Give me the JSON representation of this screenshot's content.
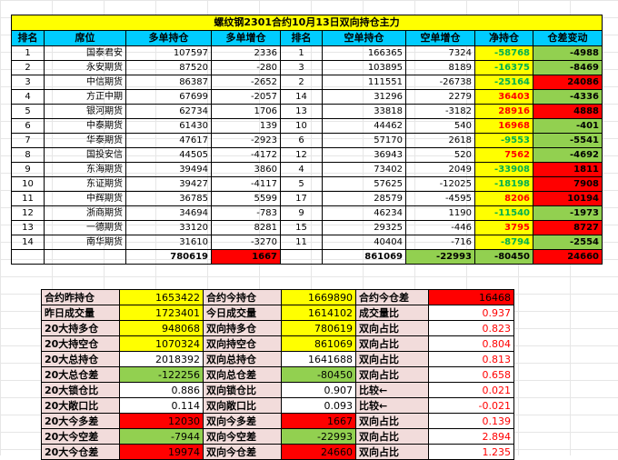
{
  "title": "螺纹钢2301合约10月13日双向持仓主力",
  "headers": [
    "排名",
    "席位",
    "多单持仓",
    "多单增仓",
    "排名",
    "空单持仓",
    "空单增仓",
    "净持仓",
    "仓差变动"
  ],
  "rows": [
    {
      "rank": "1",
      "broker": "国泰君安",
      "long": "107597",
      "long_chg": "2336",
      "srank": "1",
      "short": "166365",
      "short_chg": "7324",
      "net": "-58768",
      "diff": "-4988",
      "net_color": "yel",
      "net_text": "lgreen",
      "diff_color": "grn"
    },
    {
      "rank": "2",
      "broker": "永安期货",
      "long": "87520",
      "long_chg": "-280",
      "srank": "3",
      "short": "103895",
      "short_chg": "8189",
      "net": "-16375",
      "diff": "-8469",
      "net_color": "yel",
      "net_text": "lgreen",
      "diff_color": "grn"
    },
    {
      "rank": "3",
      "broker": "中信期货",
      "long": "86387",
      "long_chg": "-2652",
      "srank": "2",
      "short": "111551",
      "short_chg": "-26738",
      "net": "-25164",
      "diff": "24086",
      "net_color": "yel",
      "net_text": "lgreen",
      "diff_color": "red"
    },
    {
      "rank": "4",
      "broker": "方正中期",
      "long": "67699",
      "long_chg": "-2057",
      "srank": "14",
      "short": "31296",
      "short_chg": "2279",
      "net": "36403",
      "diff": "-4336",
      "net_color": "yel",
      "net_text": "red",
      "diff_color": "grn"
    },
    {
      "rank": "5",
      "broker": "银河期货",
      "long": "62734",
      "long_chg": "1706",
      "srank": "13",
      "short": "33818",
      "short_chg": "-3182",
      "net": "28916",
      "diff": "4888",
      "net_color": "yel",
      "net_text": "red",
      "diff_color": "red"
    },
    {
      "rank": "6",
      "broker": "中泰期货",
      "long": "61430",
      "long_chg": "139",
      "srank": "10",
      "short": "44462",
      "short_chg": "540",
      "net": "16968",
      "diff": "-401",
      "net_color": "yel",
      "net_text": "red",
      "diff_color": "grn"
    },
    {
      "rank": "7",
      "broker": "华泰期货",
      "long": "47617",
      "long_chg": "-2923",
      "srank": "6",
      "short": "57170",
      "short_chg": "2618",
      "net": "-9553",
      "diff": "-5541",
      "net_color": "yel",
      "net_text": "lgreen",
      "diff_color": "grn"
    },
    {
      "rank": "8",
      "broker": "国投安信",
      "long": "44505",
      "long_chg": "-4172",
      "srank": "12",
      "short": "36943",
      "short_chg": "520",
      "net": "7562",
      "diff": "-4692",
      "net_color": "yel",
      "net_text": "red",
      "diff_color": "grn"
    },
    {
      "rank": "9",
      "broker": "东海期货",
      "long": "39494",
      "long_chg": "3860",
      "srank": "4",
      "short": "73402",
      "short_chg": "2049",
      "net": "-33908",
      "diff": "1811",
      "net_color": "yel",
      "net_text": "lgreen",
      "diff_color": "red"
    },
    {
      "rank": "10",
      "broker": "东证期货",
      "long": "39427",
      "long_chg": "-4117",
      "srank": "5",
      "short": "57625",
      "short_chg": "-12025",
      "net": "-18198",
      "diff": "7908",
      "net_color": "yel",
      "net_text": "lgreen",
      "diff_color": "red"
    },
    {
      "rank": "11",
      "broker": "中辉期货",
      "long": "36785",
      "long_chg": "5599",
      "srank": "17",
      "short": "28579",
      "short_chg": "-4595",
      "net": "8206",
      "diff": "10194",
      "net_color": "yel",
      "net_text": "red",
      "diff_color": "red"
    },
    {
      "rank": "12",
      "broker": "浙商期货",
      "long": "34694",
      "long_chg": "-783",
      "srank": "9",
      "short": "46234",
      "short_chg": "1190",
      "net": "-11540",
      "diff": "-1973",
      "net_color": "yel",
      "net_text": "lgreen",
      "diff_color": "grn"
    },
    {
      "rank": "13",
      "broker": "一德期货",
      "long": "33120",
      "long_chg": "8281",
      "srank": "15",
      "short": "29325",
      "short_chg": "-446",
      "net": "3795",
      "diff": "8727",
      "net_color": "yel",
      "net_text": "red",
      "diff_color": "red"
    },
    {
      "rank": "14",
      "broker": "南华期货",
      "long": "31610",
      "long_chg": "-3270",
      "srank": "11",
      "short": "40404",
      "short_chg": "-716",
      "net": "-8794",
      "diff": "-2554",
      "net_color": "yel",
      "net_text": "lgreen",
      "diff_color": "grn"
    }
  ],
  "totals": {
    "long": "780619",
    "long_chg": "1667",
    "short": "861069",
    "short_chg": "-22993",
    "net": "-80450",
    "diff": "24660"
  },
  "summary": [
    {
      "l1": "合约昨持仓",
      "v1": "1653422",
      "c1": "yel",
      "l2": "合约今持仓",
      "v2": "1669890",
      "c2": "yel",
      "l3": "合约今仓差",
      "v3": "16468",
      "c3": "red"
    },
    {
      "l1": "昨日成交量",
      "v1": "1723401",
      "c1": "yel",
      "l2": "今日成交量",
      "v2": "1614102",
      "c2": "yel",
      "l3": "成交量比",
      "v3": "0.937",
      "c3": "ws"
    },
    {
      "l1": "20大持多仓",
      "v1": "948068",
      "c1": "yel",
      "l2": "双向持多仓",
      "v2": "780619",
      "c2": "yel",
      "l3": "双向占比",
      "v3": "0.823",
      "c3": "ws"
    },
    {
      "l1": "20大持空仓",
      "v1": "1070324",
      "c1": "yel",
      "l2": "双向持空仓",
      "v2": "861069",
      "c2": "yel",
      "l3": "双向占比",
      "v3": "0.804",
      "c3": "ws"
    },
    {
      "l1": "20大总持仓",
      "v1": "2018392",
      "c1": "ws",
      "l2": "双向总持仓",
      "v2": "1641688",
      "c2": "ws",
      "l3": "双向占比",
      "v3": "0.813",
      "c3": "ws"
    },
    {
      "l1": "20大总仓差",
      "v1": "-122256",
      "c1": "grn",
      "l2": "双向总仓差",
      "v2": "-80450",
      "c2": "grn",
      "l3": "双向占比",
      "v3": "0.658",
      "c3": "ws"
    },
    {
      "l1": "20大锁仓比",
      "v1": "0.886",
      "c1": "ws",
      "l2": "双向锁仓比",
      "v2": "0.907",
      "c2": "ws",
      "l3": "比较←",
      "v3": "0.021",
      "c3": "ws"
    },
    {
      "l1": "20大敞口比",
      "v1": "0.114",
      "c1": "ws",
      "l2": "双向敞口比",
      "v2": "0.093",
      "c2": "ws",
      "l3": "比较←",
      "v3": "-0.021",
      "c3": "ws"
    },
    {
      "l1": "20大今多差",
      "v1": "12030",
      "c1": "red",
      "l2": "双向今多差",
      "v2": "1667",
      "c2": "red",
      "l3": "双向占比",
      "v3": "0.139",
      "c3": "ws"
    },
    {
      "l1": "20大今空差",
      "v1": "-7944",
      "c1": "grn",
      "l2": "双向今空差",
      "v2": "-22993",
      "c2": "grn",
      "l3": "双向占比",
      "v3": "2.894",
      "c3": "ws"
    },
    {
      "l1": "20大今仓差",
      "v1": "19974",
      "c1": "red",
      "l2": "双向今仓差",
      "v2": "24660",
      "c2": "red",
      "l3": "双向占比",
      "v3": "1.235",
      "c3": "ws"
    }
  ]
}
